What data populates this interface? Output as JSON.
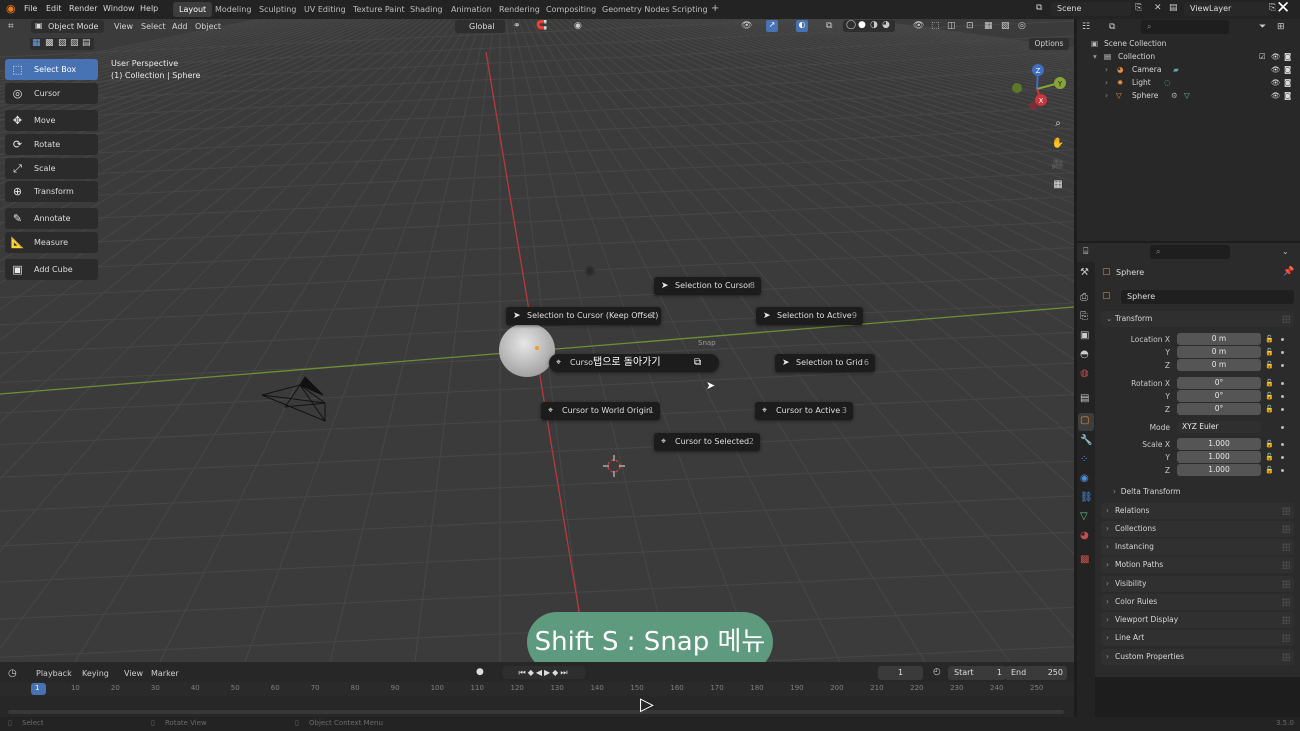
{
  "topbar": {
    "menus": [
      "File",
      "Edit",
      "Render",
      "Window",
      "Help"
    ],
    "workspaces": [
      "Layout",
      "Modeling",
      "Sculpting",
      "UV Editing",
      "Texture Paint",
      "Shading",
      "Animation",
      "Rendering",
      "Compositing",
      "Geometry Nodes",
      "Scripting"
    ],
    "active_workspace": "Layout",
    "add_tab": "+",
    "scene": "Scene",
    "view_layer": "ViewLayer"
  },
  "viewport_header": {
    "mode": "Object Mode",
    "menus": [
      "View",
      "Select",
      "Add",
      "Object"
    ],
    "orientation": "Global",
    "options": "Options"
  },
  "viewport": {
    "perspective": "User Perspective",
    "collection_info": "(1) Collection | Sphere"
  },
  "toolbox": [
    {
      "label": "Select Box",
      "icon": "select-box-icon",
      "glyph": "⬚",
      "active": true
    },
    {
      "label": "Cursor",
      "icon": "cursor-icon",
      "glyph": "◎",
      "active": false
    },
    {
      "label": "Move",
      "icon": "move-icon",
      "glyph": "✥",
      "active": false
    },
    {
      "label": "Rotate",
      "icon": "rotate-icon",
      "glyph": "⟳",
      "active": false
    },
    {
      "label": "Scale",
      "icon": "scale-icon",
      "glyph": "⤢",
      "active": false
    },
    {
      "label": "Transform",
      "icon": "transform-icon",
      "glyph": "⊕",
      "active": false
    },
    {
      "label": "Annotate",
      "icon": "annotate-icon",
      "glyph": "✎",
      "active": false
    },
    {
      "label": "Measure",
      "icon": "measure-icon",
      "glyph": "📐",
      "active": false
    },
    {
      "label": "Add Cube",
      "icon": "add-cube-icon",
      "glyph": "▣",
      "active": false
    }
  ],
  "snap_menu": {
    "title": "Snap",
    "items": [
      {
        "label": "Selection to Cursor",
        "key": "8"
      },
      {
        "label": "Selection to Cursor (Keep Offset)",
        "key": "7"
      },
      {
        "label": "Selection to Active",
        "key": "9"
      },
      {
        "label": "Curso",
        "key": ""
      },
      {
        "label": "Selection to Grid",
        "key": "6"
      },
      {
        "label": "Cursor to World Origin",
        "key": "1"
      },
      {
        "label": "Cursor to Active",
        "key": "3"
      },
      {
        "label": "Cursor to Selected",
        "key": "2"
      }
    ],
    "tooltip": "탭으로 돌아가기"
  },
  "caption": "Shift S : Snap 메뉴",
  "gizmo": {
    "z": "Z",
    "y": "Y",
    "x": "X"
  },
  "timeline": {
    "menus": [
      "Playback",
      "Keying",
      "View",
      "Marker"
    ],
    "current_frame": "1",
    "start_label": "Start",
    "start": "1",
    "end_label": "End",
    "end": "250",
    "ruler": [
      "1",
      "10",
      "20",
      "30",
      "40",
      "50",
      "60",
      "70",
      "80",
      "90",
      "100",
      "110",
      "120",
      "130",
      "140",
      "150",
      "160",
      "170",
      "180",
      "190",
      "200",
      "210",
      "220",
      "230",
      "240",
      "250"
    ]
  },
  "status_bar": {
    "select": "Select",
    "rotate": "Rotate View",
    "context": "Object Context Menu",
    "version": "3.5.0"
  },
  "outliner": {
    "scene_collection": "Scene Collection",
    "collection": "Collection",
    "items": [
      "Camera",
      "Light",
      "Sphere"
    ]
  },
  "properties": {
    "object_name": "Sphere",
    "datablock": "Sphere",
    "transform_title": "Transform",
    "location": {
      "label_x": "Location X",
      "x": "0 m",
      "y": "0 m",
      "z": "0 m"
    },
    "rotation": {
      "label_x": "Rotation X",
      "x": "0°",
      "y": "0°",
      "z": "0°"
    },
    "mode_label": "Mode",
    "mode": "XYZ Euler",
    "scale": {
      "label_x": "Scale X",
      "x": "1.000",
      "y": "1.000",
      "z": "1.000"
    },
    "axis_y": "Y",
    "axis_z": "Z",
    "delta_transform": "Delta Transform",
    "panels": [
      "Relations",
      "Collections",
      "Instancing",
      "Motion Paths",
      "Visibility",
      "Color Rules",
      "Viewport Display",
      "Line Art",
      "Custom Properties"
    ]
  },
  "colors": {
    "accent": "#4772b3",
    "x_axis": "#7ba33b",
    "y_axis": "#c0392b",
    "caption_bg": "#5e9b7e"
  }
}
